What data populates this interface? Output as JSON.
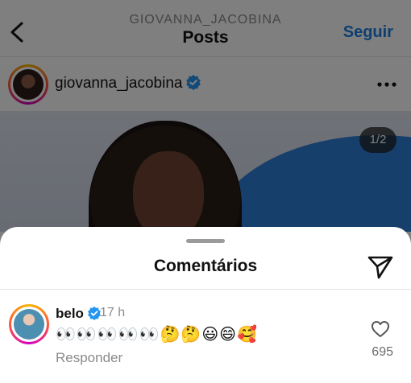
{
  "header": {
    "username": "GIOVANNA_JACOBINA",
    "title": "Posts",
    "follow_label": "Seguir",
    "back_icon": "chevron-left-icon"
  },
  "post": {
    "username": "giovanna_jacobina",
    "verified": true,
    "more_icon": "more-horizontal-icon",
    "photo_counter": "1/2"
  },
  "comments_sheet": {
    "title": "Comentários",
    "share_icon": "send-icon",
    "comments": [
      {
        "username": "belo",
        "verified": true,
        "time": "17 h",
        "text": "👀👀👀👀👀🤔🤔😃😄🥰",
        "reply_label": "Responder",
        "likes": "695",
        "like_icon": "heart-outline-icon"
      }
    ]
  },
  "colors": {
    "accent": "#1d7fe0",
    "verified": "#2596f0",
    "story_ring": [
      "#f9b600",
      "#ff5a3c",
      "#d300c5"
    ]
  }
}
